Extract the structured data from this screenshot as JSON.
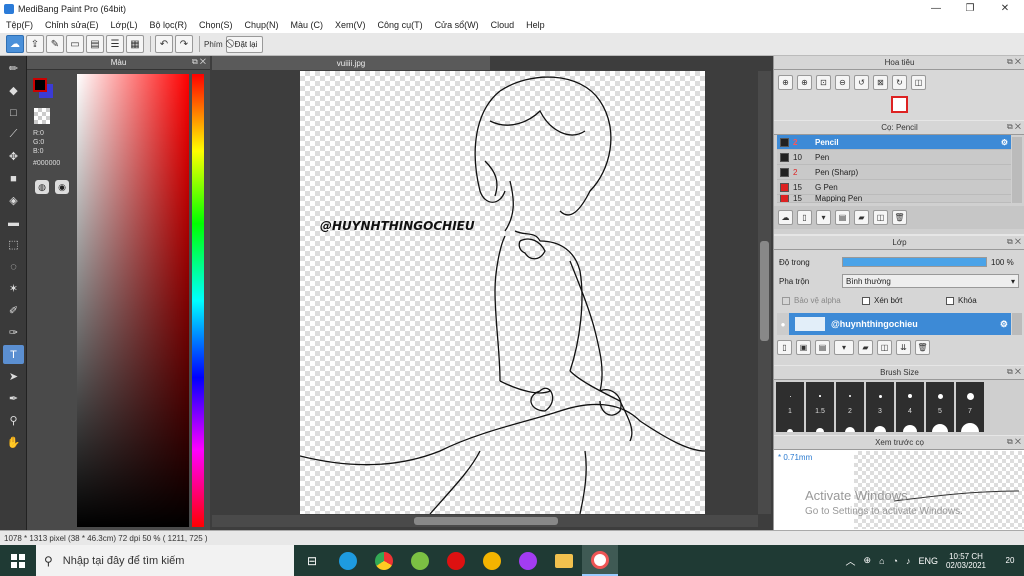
{
  "window": {
    "title": "MediBang Paint Pro (64bit)",
    "min": "—",
    "max": "❐",
    "close": "✕"
  },
  "menu": [
    "Tệp(F)",
    "Chỉnh sửa(E)",
    "Lớp(L)",
    "Bộ lọc(R)",
    "Chọn(S)",
    "Chụp(N)",
    "Màu (C)",
    "Xem(V)",
    "Công cụ(T)",
    "Cửa sổ(W)",
    "Cloud",
    "Help"
  ],
  "toolbar": {
    "phim_label": "Phím",
    "reset_label": "Đặt lại"
  },
  "color_panel": {
    "title": "Màu",
    "r": "R:0",
    "g": "G:0",
    "b": "B:0",
    "hex": "#000000"
  },
  "canvas": {
    "tab": "vuiiii.jpg",
    "watermark": "@HUYNHTHINGOCHIEU"
  },
  "navigator": {
    "title": "Hoa tiêu"
  },
  "brush_panel": {
    "title": "Cọ: Pencil",
    "items": [
      {
        "size": "2",
        "name": "Pencil",
        "selected": true,
        "color": "#222222"
      },
      {
        "size": "10",
        "name": "Pen",
        "selected": false,
        "color": "#222222"
      },
      {
        "size": "2",
        "name": "Pen (Sharp)",
        "selected": false,
        "color": "#222222"
      },
      {
        "size": "15",
        "name": "G Pen",
        "selected": false,
        "color": "#dd2222"
      },
      {
        "size": "15",
        "name": "Mapping Pen",
        "selected": false,
        "color": "#dd2222"
      }
    ]
  },
  "layer_panel": {
    "title": "Lớp",
    "opacity_label": "Độ trong",
    "opacity_value": "100 %",
    "opacity_fraction": 1.0,
    "blend_label": "Pha trộn",
    "blend_value": "Bình thường",
    "protect_alpha": "Bảo vệ alpha",
    "clipping": "Xén bớt",
    "lock": "Khóa",
    "layer_name": "@huynhthingochieu"
  },
  "brush_size": {
    "title": "Brush Size",
    "sizes": [
      "1",
      "1.5",
      "2",
      "3",
      "4",
      "5",
      "7"
    ]
  },
  "preview": {
    "title": "Xem trước cọ",
    "size": "* 0.71mm",
    "activate_line1": "Activate Windows",
    "activate_line2": "Go to Settings to activate Windows."
  },
  "status": {
    "text": "1078 * 1313 pixel   (38 * 46.3cm)   72 dpi   50 %   ( 1211, 725 )"
  },
  "taskbar": {
    "search_placeholder": "Nhập tại đây để tìm kiếm",
    "lang": "ENG",
    "time": "10:57 CH",
    "date": "02/03/2021",
    "notif": "20"
  }
}
